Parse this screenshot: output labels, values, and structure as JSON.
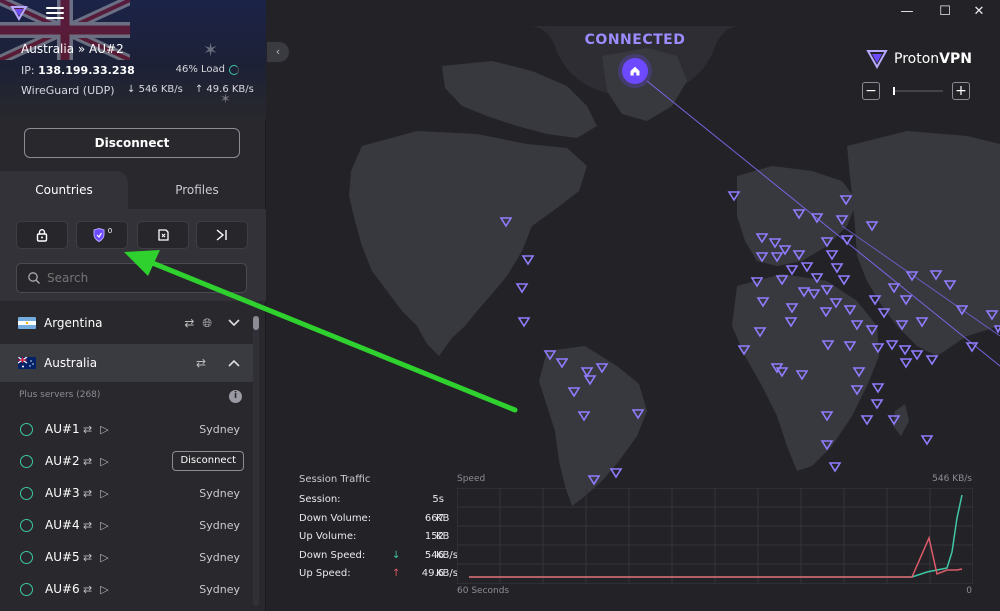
{
  "window": {
    "minimize": "—",
    "maximize": "☐",
    "close": "✕"
  },
  "connection": {
    "server": "Australia » AU#2",
    "ip_label": "IP:",
    "ip": "138.199.33.238",
    "load": "46% Load",
    "protocol": "WireGuard (UDP)",
    "download": "546 KB/s",
    "upload": "49.6 KB/s",
    "disconnect_label": "Disconnect"
  },
  "tabs": {
    "countries": "Countries",
    "profiles": "Profiles"
  },
  "filters": {
    "secure_core_badge": "0"
  },
  "search": {
    "placeholder": "Search"
  },
  "countries": [
    {
      "name": "Argentina"
    },
    {
      "name": "Australia"
    }
  ],
  "plus_servers_label": "Plus servers (268)",
  "servers": [
    {
      "name": "AU#1",
      "city": "Sydney"
    },
    {
      "name": "AU#2",
      "action": "Disconnect"
    },
    {
      "name": "AU#3",
      "city": "Sydney"
    },
    {
      "name": "AU#4",
      "city": "Sydney"
    },
    {
      "name": "AU#5",
      "city": "Sydney"
    },
    {
      "name": "AU#6",
      "city": "Sydney"
    }
  ],
  "map": {
    "status": "CONNECTED",
    "brand_a": "Proton",
    "brand_b": "VPN",
    "zoom_out": "−",
    "zoom_in": "+"
  },
  "session": {
    "title": "Session Traffic",
    "rows": [
      {
        "label": "Session:",
        "value": "5s",
        "unit": ""
      },
      {
        "label": "Down Volume:",
        "value": "667",
        "unit": "KB"
      },
      {
        "label": "Up Volume:",
        "value": "152",
        "unit": "KB"
      },
      {
        "label": "Down Speed:",
        "value": "546",
        "unit": "KB/s"
      },
      {
        "label": "Up Speed:",
        "value": "49.6",
        "unit": "KB/s"
      }
    ],
    "speed_label": "Speed",
    "speed_max": "546  KB/s",
    "time_label": "60 Seconds",
    "zero_label": "0"
  },
  "colors": {
    "accent": "#6d4aff",
    "connected_text": "#9b8cff",
    "down_series": "#3fc7a6",
    "up_series": "#e05a6a",
    "annotation_arrow": "#2fd12f"
  }
}
